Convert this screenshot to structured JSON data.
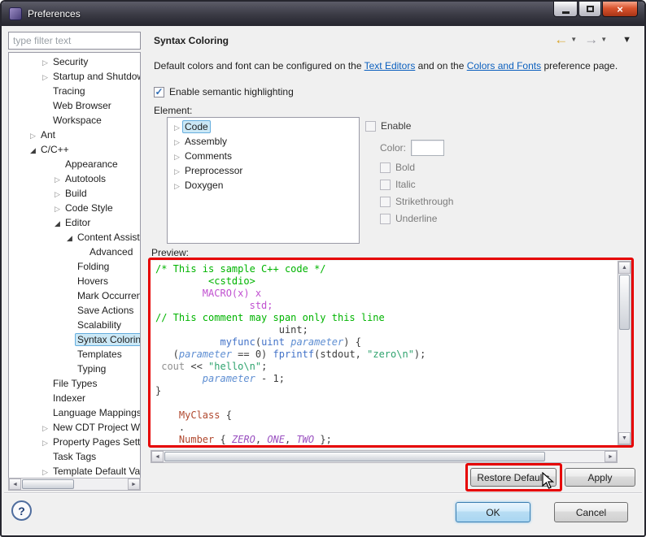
{
  "window": {
    "title": "Preferences"
  },
  "icons": {
    "minimize": "–",
    "maximize": "□",
    "close": "×",
    "check": "✓",
    "collapsed": "▷",
    "expanded": "◢",
    "back": "←",
    "forward": "→",
    "dropdown": "▼",
    "collapse": "▼",
    "up": "▲",
    "down": "▼",
    "left": "◄",
    "right": "►"
  },
  "sidebar": {
    "filter_placeholder": "type filter text",
    "tree": [
      {
        "label": "Security",
        "level": 1,
        "state": "collapsed"
      },
      {
        "label": "Startup and Shutdow",
        "level": 1,
        "state": "collapsed"
      },
      {
        "label": "Tracing",
        "level": 1,
        "state": "none"
      },
      {
        "label": "Web Browser",
        "level": 1,
        "state": "none"
      },
      {
        "label": "Workspace",
        "level": 1,
        "state": "none"
      },
      {
        "label": "Ant",
        "level": 0,
        "state": "collapsed"
      },
      {
        "label": "C/C++",
        "level": 0,
        "state": "expanded"
      },
      {
        "label": "Appearance",
        "level": 2,
        "state": "none"
      },
      {
        "label": "Autotools",
        "level": 2,
        "state": "collapsed"
      },
      {
        "label": "Build",
        "level": 2,
        "state": "collapsed"
      },
      {
        "label": "Code Style",
        "level": 2,
        "state": "collapsed"
      },
      {
        "label": "Editor",
        "level": 2,
        "state": "expanded"
      },
      {
        "label": "Content Assist",
        "level": 3,
        "state": "expanded"
      },
      {
        "label": "Advanced",
        "level": 4,
        "state": "none"
      },
      {
        "label": "Folding",
        "level": 3,
        "state": "none"
      },
      {
        "label": "Hovers",
        "level": 3,
        "state": "none"
      },
      {
        "label": "Mark Occurrence",
        "level": 3,
        "state": "none"
      },
      {
        "label": "Save Actions",
        "level": 3,
        "state": "none"
      },
      {
        "label": "Scalability",
        "level": 3,
        "state": "none"
      },
      {
        "label": "Syntax Coloring",
        "level": 3,
        "state": "none",
        "selected": true
      },
      {
        "label": "Templates",
        "level": 3,
        "state": "none"
      },
      {
        "label": "Typing",
        "level": 3,
        "state": "none"
      },
      {
        "label": "File Types",
        "level": 1,
        "state": "none"
      },
      {
        "label": "Indexer",
        "level": 1,
        "state": "none"
      },
      {
        "label": "Language Mappings",
        "level": 1,
        "state": "none"
      },
      {
        "label": "New CDT Project Wi",
        "level": 1,
        "state": "collapsed"
      },
      {
        "label": "Property Pages Setti",
        "level": 1,
        "state": "collapsed"
      },
      {
        "label": "Task Tags",
        "level": 1,
        "state": "none"
      },
      {
        "label": "Template Default Va",
        "level": 1,
        "state": "collapsed"
      }
    ]
  },
  "header": {
    "title": "Syntax Coloring"
  },
  "description": {
    "prefix": "Default colors and font can be configured on the ",
    "link1": "Text Editors",
    "middle": " and on the ",
    "link2": "Colors and Fonts",
    "suffix": " preference page."
  },
  "semantic": {
    "label": "Enable semantic highlighting",
    "checked": true
  },
  "element": {
    "label": "Element:",
    "items": [
      {
        "label": "Code",
        "selected": true
      },
      {
        "label": "Assembly"
      },
      {
        "label": "Comments"
      },
      {
        "label": "Preprocessor"
      },
      {
        "label": "Doxygen"
      }
    ]
  },
  "style_controls": {
    "enable_label": "Enable",
    "color_label": "Color:",
    "bold_label": "Bold",
    "italic_label": "Italic",
    "strikethrough_label": "Strikethrough",
    "underline_label": "Underline"
  },
  "preview": {
    "label": "Preview:",
    "lines": [
      [
        {
          "t": "/* This is sample C++ code */",
          "c": "comment"
        }
      ],
      [
        {
          "t": "         ",
          "c": "plain"
        },
        {
          "t": "<cstdio>",
          "c": "comment"
        }
      ],
      [
        {
          "t": "        ",
          "c": "plain"
        },
        {
          "t": "MACRO(x) x",
          "c": "macro"
        }
      ],
      [
        {
          "t": "                ",
          "c": "plain"
        },
        {
          "t": "std;",
          "c": "macro"
        }
      ],
      [
        {
          "t": "// This comment may span only this line",
          "c": "comment"
        }
      ],
      [
        {
          "t": "                     ",
          "c": "plain"
        },
        {
          "t": "uint;",
          "c": "plain"
        }
      ],
      [
        {
          "t": "           ",
          "c": "plain"
        },
        {
          "t": "myfunc",
          "c": "func"
        },
        {
          "t": "(",
          "c": "plain"
        },
        {
          "t": "uint",
          "c": "func"
        },
        {
          "t": " ",
          "c": "plain"
        },
        {
          "t": "parameter",
          "c": "param"
        },
        {
          "t": ") {",
          "c": "plain"
        }
      ],
      [
        {
          "t": "   (",
          "c": "plain"
        },
        {
          "t": "parameter",
          "c": "param"
        },
        {
          "t": " == 0) ",
          "c": "plain"
        },
        {
          "t": "fprintf",
          "c": "func"
        },
        {
          "t": "(stdout, ",
          "c": "plain"
        },
        {
          "t": "\"zero\\n\"",
          "c": "string"
        },
        {
          "t": ");",
          "c": "plain"
        }
      ],
      [
        {
          "t": " ",
          "c": "plain"
        },
        {
          "t": "cout",
          "c": "gray"
        },
        {
          "t": " << ",
          "c": "plain"
        },
        {
          "t": "\"hello\\n\"",
          "c": "string"
        },
        {
          "t": ";",
          "c": "plain"
        }
      ],
      [
        {
          "t": "        ",
          "c": "plain"
        },
        {
          "t": "parameter",
          "c": "param"
        },
        {
          "t": " - 1;",
          "c": "plain"
        }
      ],
      [
        {
          "t": "}",
          "c": "plain"
        }
      ],
      [],
      [
        {
          "t": "    ",
          "c": "plain"
        },
        {
          "t": "MyClass",
          "c": "class"
        },
        {
          "t": " {",
          "c": "plain"
        }
      ],
      [
        {
          "t": "    .",
          "c": "plain"
        }
      ],
      [
        {
          "t": "    ",
          "c": "plain"
        },
        {
          "t": "Number",
          "c": "class"
        },
        {
          "t": " { ",
          "c": "plain"
        },
        {
          "t": "ZERO",
          "c": "enum"
        },
        {
          "t": ", ",
          "c": "plain"
        },
        {
          "t": "ONE",
          "c": "enum"
        },
        {
          "t": ", ",
          "c": "plain"
        },
        {
          "t": "TWO",
          "c": "enum"
        },
        {
          "t": " };",
          "c": "plain"
        }
      ]
    ]
  },
  "buttons": {
    "restore_defaults": "Restore Defaults",
    "apply": "Apply",
    "ok": "OK",
    "cancel": "Cancel"
  },
  "help": {
    "label": "?"
  },
  "colors": {
    "annotation_red": "#e60000",
    "link_blue": "#0b5fbe",
    "selection_bg": "#cbe8f6",
    "comment_green": "#00b400",
    "macro_purple": "#c050d0",
    "function_blue": "#4272c8",
    "string_teal": "#2fa36e",
    "class_brown": "#b0482e",
    "enum_purple": "#9a50c0",
    "titlebar_dark": "#34343e",
    "close_red": "#d9542e"
  }
}
